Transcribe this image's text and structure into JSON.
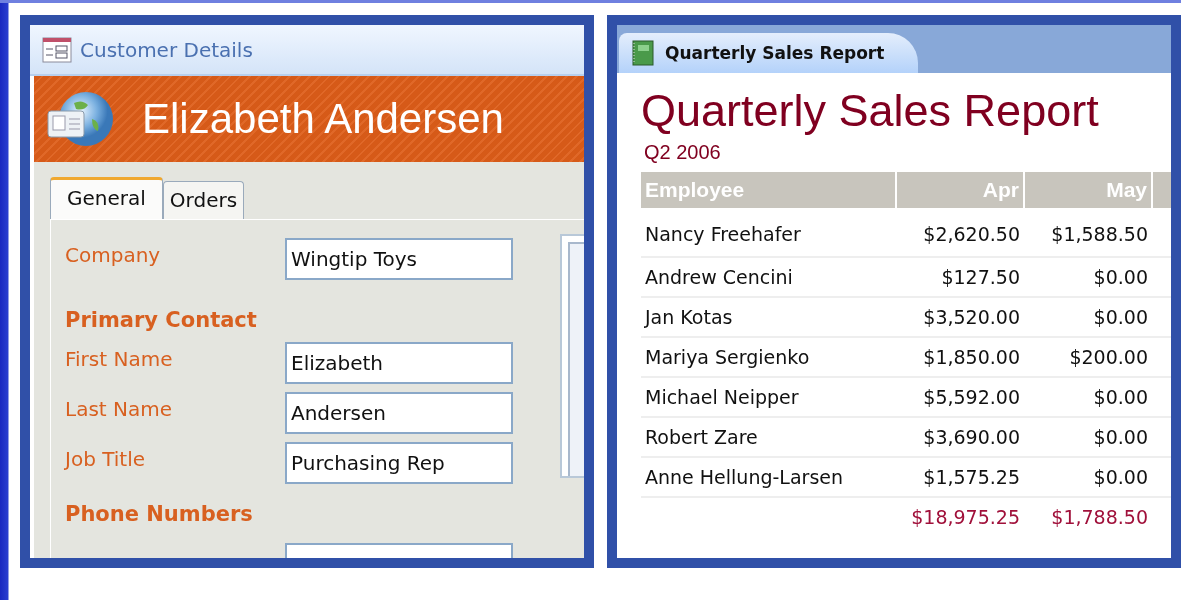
{
  "customer_form": {
    "window": {
      "title": "Customer Details"
    },
    "header": {
      "name": "Elizabeth Andersen"
    },
    "tabs": [
      {
        "label": "General",
        "selected": true
      },
      {
        "label": "Orders",
        "selected": false
      }
    ],
    "fields": [
      {
        "kind": "field",
        "label": "Company",
        "value": "Wingtip Toys"
      },
      {
        "kind": "section",
        "label": "Primary Contact"
      },
      {
        "kind": "field",
        "label": "First Name",
        "value": "Elizabeth"
      },
      {
        "kind": "field",
        "label": "Last Name",
        "value": "Andersen"
      },
      {
        "kind": "field",
        "label": "Job Title",
        "value": "Purchasing Rep"
      },
      {
        "kind": "section",
        "label": "Phone Numbers"
      }
    ]
  },
  "sales_report": {
    "tab": {
      "label": "Quarterly Sales Report"
    },
    "title": "Quarterly Sales Report",
    "subtitle": "Q2 2006",
    "table": {
      "columns": [
        "Employee",
        "Apr",
        "May"
      ],
      "rows": [
        [
          "Nancy Freehafer",
          "$2,620.50",
          "$1,588.50"
        ],
        [
          "Andrew Cencini",
          "$127.50",
          "$0.00"
        ],
        [
          "Jan Kotas",
          "$3,520.00",
          "$0.00"
        ],
        [
          "Mariya Sergienko",
          "$1,850.00",
          "$200.00"
        ],
        [
          "Michael Neipper",
          "$5,592.00",
          "$0.00"
        ],
        [
          "Robert Zare",
          "$3,690.00",
          "$0.00"
        ],
        [
          "Anne Hellung-Larsen",
          "$1,575.25",
          "$0.00"
        ]
      ],
      "totals": [
        "$18,975.25",
        "$1,788.50"
      ]
    }
  }
}
